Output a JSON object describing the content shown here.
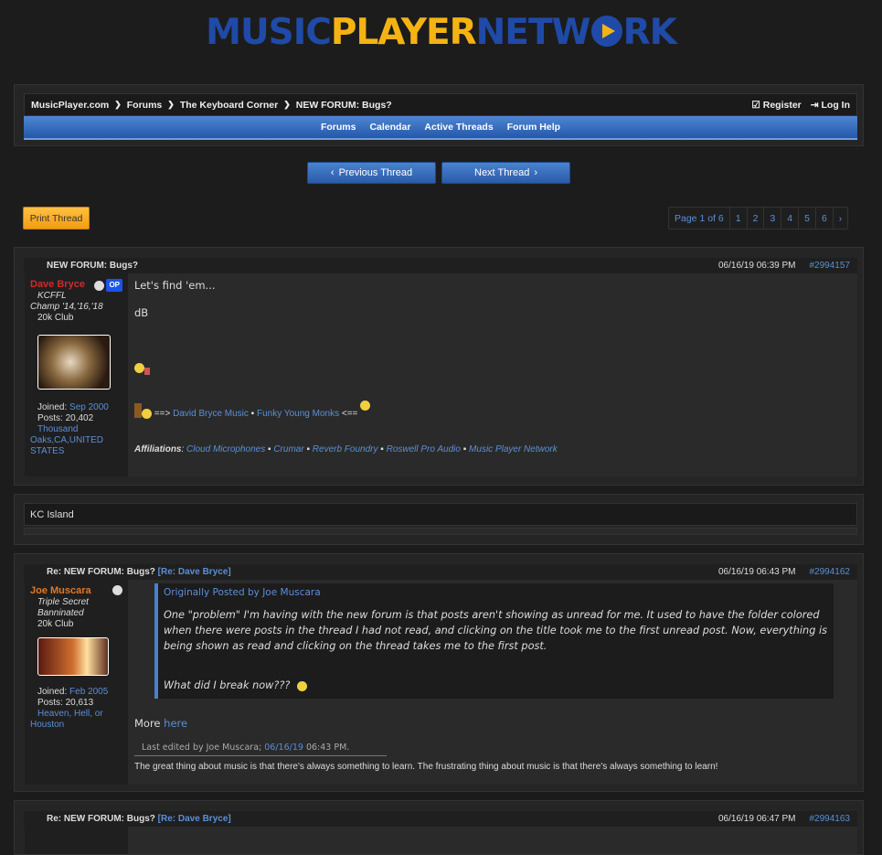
{
  "logo": {
    "text": [
      "MUSIC",
      "PLAYER",
      "NETW",
      "RK"
    ]
  },
  "breadcrumb": [
    "MusicPlayer.com",
    "Forums",
    "The Keyboard Corner",
    "NEW FORUM: Bugs?"
  ],
  "header": {
    "register": "Register",
    "login": "Log In"
  },
  "nav": [
    "Forums",
    "Calendar",
    "Active Threads",
    "Forum Help"
  ],
  "thread_nav": {
    "prev": "Previous Thread",
    "next": "Next Thread"
  },
  "print": "Print Thread",
  "pager": {
    "label": "Page 1 of 6",
    "pages": [
      "1",
      "2",
      "3",
      "4",
      "5",
      "6"
    ]
  },
  "posts": [
    {
      "title": "NEW FORUM: Bugs?",
      "date": "06/16/19 06:39 PM",
      "num": "#2994157",
      "user": "Dave Bryce",
      "badge": "OP",
      "titles": [
        "KCFFL",
        "Champ '14,'16,'18",
        "20k Club"
      ],
      "joined_label": "Joined:",
      "joined": "Sep 2000",
      "posts_label": "Posts:",
      "posts": "20,402",
      "location": [
        "Thousand",
        "Oaks,CA,UNITED STATES"
      ],
      "body": [
        "Let's find 'em...",
        "dB"
      ],
      "sig_pre": "==>",
      "sig_links": [
        "David Bryce Music",
        "Funky Young Monks"
      ],
      "sig_post": "<==",
      "aff_label": "Affiliations",
      "aff": [
        "Cloud Microphones",
        "Crumar",
        "Reverb Foundry",
        "Roswell Pro Audio",
        "Music Player Network"
      ]
    },
    {
      "title": "Re: NEW FORUM: Bugs?",
      "reply": "[Re: Dave Bryce]",
      "date": "06/16/19 06:43 PM",
      "num": "#2994162",
      "user": "Joe Muscara",
      "titles": [
        "Triple Secret Banninated",
        "20k Club"
      ],
      "joined_label": "Joined:",
      "joined": "Feb 2005",
      "posts_label": "Posts:",
      "posts": "20,613",
      "location": [
        "Heaven, Hell, or",
        "Houston"
      ],
      "quote_by": "Originally Posted by Joe Muscara",
      "quote": "One \"problem\" I'm having with the new forum is that posts aren't showing as unread for me. It used to have the folder colored when there were posts in the thread I had not read, and clicking on the title took me to the first unread post. Now, everything is being shown as read and clicking on the thread takes me to the first post.",
      "quote2": "What did I break now???",
      "more": "More",
      "more_link": "here",
      "edited_pre": "Last edited by Joe Muscara;",
      "edited_date": "06/16/19",
      "edited_time": "06:43 PM.",
      "sig": "The great thing about music is that there's always something to learn. The frustrating thing about music is that there's always something to learn!"
    },
    {
      "title": "Re: NEW FORUM: Bugs?",
      "reply": "[Re: Dave Bryce]",
      "date": "06/16/19 06:47 PM",
      "num": "#2994163"
    }
  ],
  "kc_island": "KC Island"
}
